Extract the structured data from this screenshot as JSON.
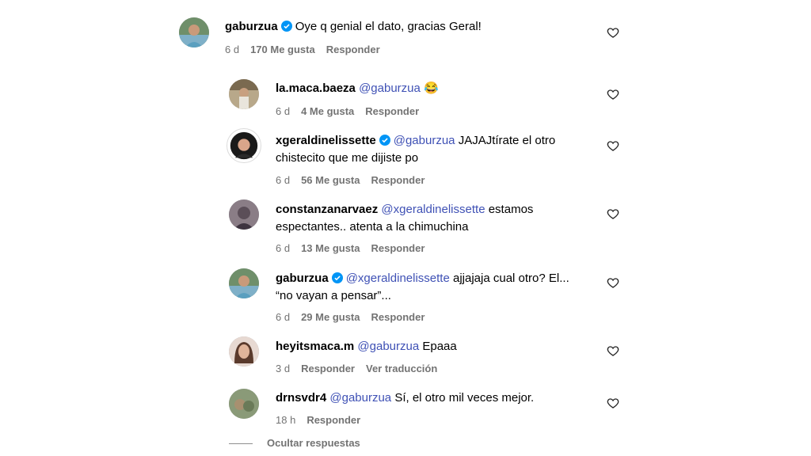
{
  "comments": [
    {
      "user": "gaburzua",
      "verified": true,
      "mention": "",
      "text": "Oye q genial el dato, gracias Geral!",
      "text2": "",
      "time": "6 d",
      "likes": "170 Me gusta",
      "reply": "Responder",
      "extra": ""
    },
    {
      "user": "la.maca.baeza",
      "verified": false,
      "mention": "@gaburzua",
      "text": "😂",
      "text2": "",
      "time": "6 d",
      "likes": "4 Me gusta",
      "reply": "Responder",
      "extra": ""
    },
    {
      "user": "xgeraldinelissette",
      "verified": true,
      "mention": "@gaburzua",
      "text": "JAJAJtírate el otro",
      "text2": "chistecito que me dijiste po",
      "time": "6 d",
      "likes": "56 Me gusta",
      "reply": "Responder",
      "extra": ""
    },
    {
      "user": "constanzanarvaez",
      "verified": false,
      "mention": "@xgeraldinelissette",
      "text": "estamos",
      "text2": "espectantes.. atenta a la chimuchina",
      "time": "6 d",
      "likes": "13 Me gusta",
      "reply": "Responder",
      "extra": ""
    },
    {
      "user": "gaburzua",
      "verified": true,
      "mention": "@xgeraldinelissette",
      "text": "ajjajaja cual otro? El...",
      "text2": "“no vayan a pensar”...",
      "time": "6 d",
      "likes": "29 Me gusta",
      "reply": "Responder",
      "extra": ""
    },
    {
      "user": "heyitsmaca.m",
      "verified": false,
      "mention": "@gaburzua",
      "text": "Epaaa",
      "text2": "",
      "time": "3 d",
      "likes": "",
      "reply": "Responder",
      "extra": "Ver traducción"
    },
    {
      "user": "drnsvdr4",
      "verified": false,
      "mention": "@gaburzua",
      "text": "Sí, el otro mil veces mejor.",
      "text2": "",
      "time": "18 h",
      "likes": "",
      "reply": "Responder",
      "extra": ""
    }
  ],
  "hide_replies": "Ocultar respuestas",
  "colors": {
    "mention": "#3f51b5",
    "verified": "#0095f6",
    "meta": "#737373"
  },
  "icons": {
    "like": "heart-outline-icon",
    "verified": "verified-badge-icon"
  }
}
